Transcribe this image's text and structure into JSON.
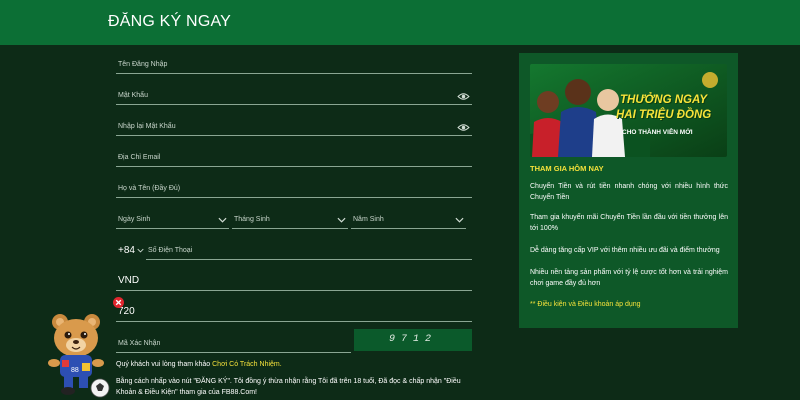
{
  "header": {
    "title": "ĐĂNG KÝ NGAY"
  },
  "form": {
    "username_placeholder": "Tên Đăng Nhập",
    "password_placeholder": "Mật Khẩu",
    "confirm_password_placeholder": "Nhập lại Mật Khẩu",
    "email_placeholder": "Địa Chỉ Email",
    "fullname_placeholder": "Họ và Tên (Đầy Đủ)",
    "birth_day": "Ngày Sinh",
    "birth_month": "Tháng Sinh",
    "birth_year": "Năm Sinh",
    "country_code": "+84",
    "phone_placeholder": "Số Điện Thoại",
    "currency": "VND",
    "number_value": "720",
    "captcha_placeholder": "Mã Xác Nhận",
    "captcha_code": "9712"
  },
  "notes": {
    "responsible_prefix": "Quý khách vui lòng tham khảo",
    "responsible_link": "Chơi Có Trách Nhiệm.",
    "terms": "Bằng cách nhấp vào nút \"ĐĂNG KÝ\". Tôi đồng ý thừa nhận rằng Tôi đã trên 18 tuổi, Đã đọc & chấp nhận \"Điều Khoản & Điều Kiện\" tham gia của FB88.Com!"
  },
  "promo": {
    "banner_line1": "THƯỞNG NGAY",
    "banner_line2": "HAI TRIỆU ĐỒNG",
    "banner_line3": "CHO THÀNH VIÊN MỚI",
    "heading": "THAM GIA HÔM NAY",
    "p1": "Chuyển Tiền và rút tiền nhanh chóng với nhiều hình thức Chuyển Tiền",
    "p2": "Tham gia khuyến mãi Chuyển Tiền lần đầu với tiền thưởng lên tới 100%",
    "p3": "Dễ dàng tăng cấp VIP với thêm nhiều ưu đãi và điểm thưởng",
    "p4": "Nhiều nền tảng sản phẩm với tỷ lệ cược tốt hơn và trải nghiệm chơi game đầy đủ hơn",
    "footer": "** Điều kiện và Điều khoản áp dụng"
  },
  "colors": {
    "header": "#0c6f35",
    "background": "#0d2b17",
    "accent_yellow": "#f5e23b",
    "panel": "#0e5828"
  },
  "icons": [
    "eye-icon",
    "chevron-down-icon",
    "error-icon",
    "mascot-bear"
  ]
}
